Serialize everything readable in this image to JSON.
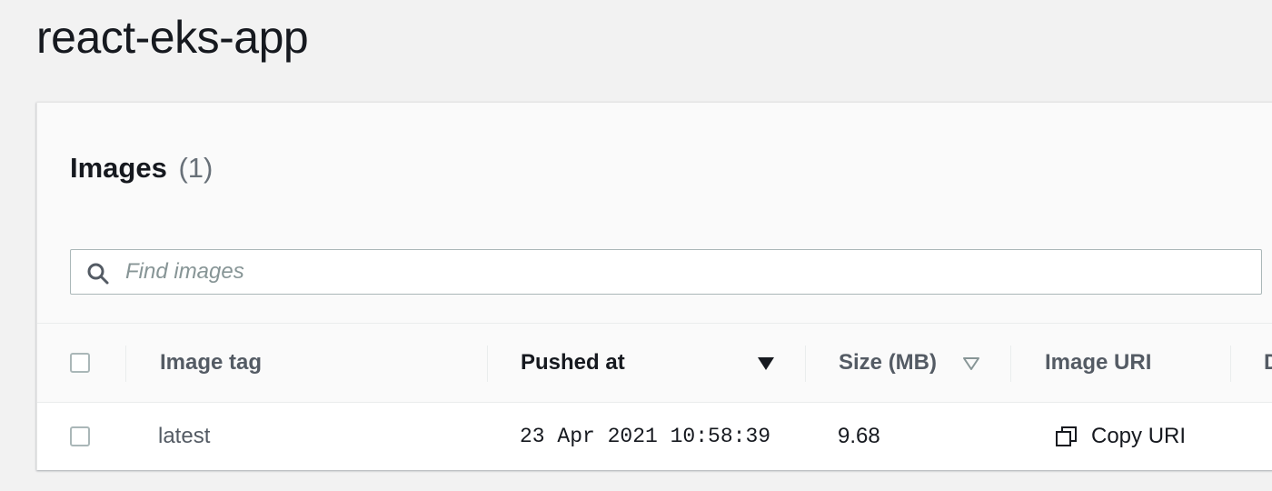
{
  "page": {
    "title": "react-eks-app"
  },
  "images_panel": {
    "title": "Images",
    "count": "(1)",
    "search": {
      "placeholder": "Find images",
      "value": "",
      "icon": "search-icon"
    },
    "table": {
      "columns": [
        {
          "label": "Image tag",
          "sort": "none"
        },
        {
          "label": "Pushed at",
          "sort": "descending"
        },
        {
          "label": "Size (MB)",
          "sort": "sortable"
        },
        {
          "label": "Image URI",
          "sort": "none"
        },
        {
          "label": "D",
          "sort": "none"
        }
      ],
      "rows": [
        {
          "checked": false,
          "image_tag": "latest",
          "pushed_at": "23 Apr 2021 10:58:39",
          "size_mb": "9.68",
          "image_uri_action": "Copy URI",
          "image_uri_icon": "copy-icon"
        }
      ]
    }
  },
  "colors": {
    "background": "#f2f2f2",
    "panel": "#fafafa",
    "text": "#16191f",
    "secondary_text": "#545b64",
    "border": "#aab7b8"
  }
}
